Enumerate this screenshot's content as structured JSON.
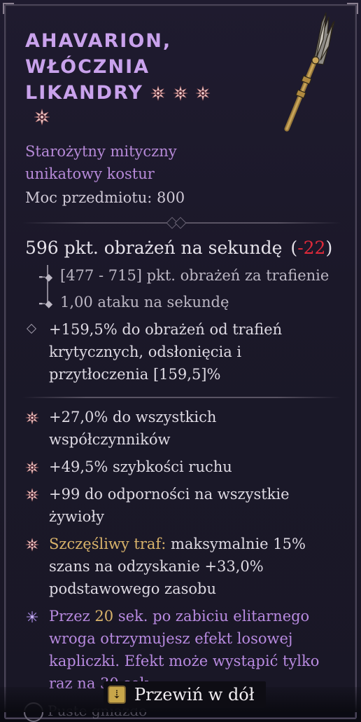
{
  "item": {
    "name_line1": "Ahavarion,",
    "name_line2": "Włócznia",
    "name_line3": "Likandry",
    "subtitle_line1": "Starożytny mityczny",
    "subtitle_line2": "unikatowy kostur",
    "power": "Moc przedmiotu: 800"
  },
  "stats": {
    "dps_text": "596 pkt. obrażeń na sekundę",
    "dps_open": "(",
    "dps_delta": "-22",
    "dps_close": ")",
    "damage_range": "[477 - 715] pkt. obrażeń za trafienie",
    "attack_speed": "1,00 ataku na sekundę",
    "implicit": "+159,5% do obrażeń od trafień krytycznych, odsłonięcia i przytłoczenia [159,5]%"
  },
  "affixes": [
    {
      "text": "+27,0% do wszystkich współczynników"
    },
    {
      "text": "+49,5% szybkości ruchu"
    },
    {
      "text": "+99 do odporności na wszystkie żywioły"
    },
    {
      "label": "Szczęśliwy traf:",
      "text": "maksymalnie 15% szans na odzyskanie +33,0% podstawowego zasobu"
    }
  ],
  "unique_power": {
    "part1": "Przez",
    "num": "20",
    "part2": "sek. po zabiciu elitarnego wroga otrzymujesz efekt losowej kapliczki. Efekt może wystąpić tylko raz na 30 sek."
  },
  "empty_socket": "Puste gniazdo",
  "scroll_hint": "Przewiń w dół",
  "colors": {
    "title": "#c9a2ec",
    "mythic_purple": "#b88ae0",
    "negative": "#e0293a",
    "gold": "#d9b36a"
  },
  "icons": [
    "mythic-star-icon",
    "staff-weapon-icon",
    "key-icon",
    "diamond-bullet-icon",
    "tree-arrow-icon"
  ]
}
